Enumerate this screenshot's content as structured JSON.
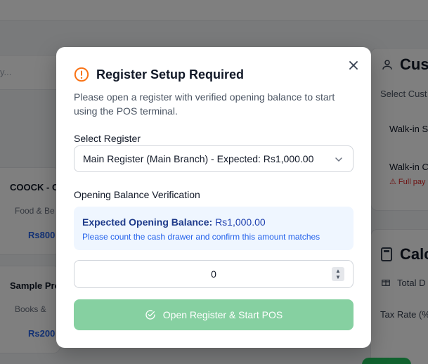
{
  "background": {
    "search_placeholder": "y...",
    "products": [
      {
        "name": "COOCK - C",
        "category": "Food & Be",
        "price": "Rs800"
      },
      {
        "name": "Sample Pro",
        "category": "Books & ",
        "price": "Rs200"
      }
    ],
    "customer_panel": {
      "title": "Cus",
      "select_label": "Select Cust",
      "option1": "Walk-in S",
      "option2": "Walk-in C",
      "warning": "⚠ Full pay"
    },
    "calc_panel": {
      "title": "Calc",
      "total_label": "Total D",
      "tax_label": "Tax Rate (%"
    }
  },
  "modal": {
    "title": "Register Setup Required",
    "description": "Please open a register with verified opening balance to start using the POS terminal.",
    "select_register_label": "Select Register",
    "selected_register": "Main Register (Main Branch) - Expected: Rs1,000.00",
    "opening_balance_label": "Opening Balance Verification",
    "expected_label": "Expected Opening Balance:",
    "expected_value": "Rs1,000.00",
    "expected_hint": "Please count the cash drawer and confirm this amount matches",
    "amount_value": "0",
    "submit_label": "Open Register & Start POS"
  },
  "colors": {
    "warning": "#f97316",
    "info_bg": "#eff6ff",
    "submit_disabled": "#86d0a1"
  }
}
